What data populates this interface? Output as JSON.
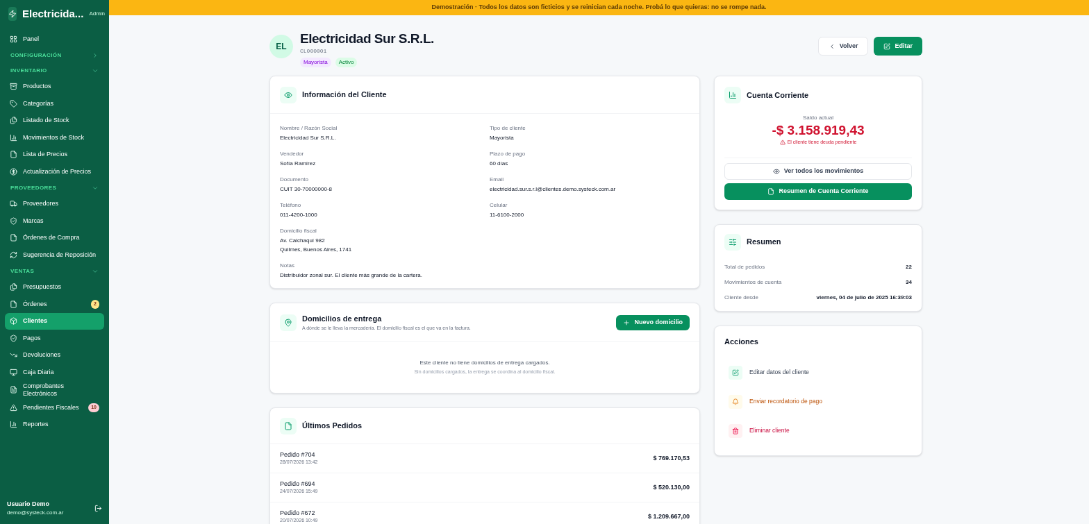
{
  "banner": "Demostración · Todos los datos son ficticios y se reinician cada noche. Probá lo que quieras: no se rompe nada.",
  "sidebar": {
    "brand": "Electricida...",
    "role": "Admin",
    "items": [
      {
        "kind": "link",
        "label": "Panel",
        "selected": false
      },
      {
        "kind": "section",
        "label": "CONFIGURACIÓN",
        "expanded": false
      },
      {
        "kind": "section",
        "label": "INVENTARIO",
        "expanded": true
      },
      {
        "kind": "link",
        "label": "Productos",
        "selected": false
      },
      {
        "kind": "link",
        "label": "Categorías",
        "selected": false
      },
      {
        "kind": "link",
        "label": "Listado de Stock",
        "selected": false
      },
      {
        "kind": "link",
        "label": "Movimientos de Stock",
        "selected": false
      },
      {
        "kind": "link",
        "label": "Lista de Precios",
        "selected": false
      },
      {
        "kind": "link",
        "label": "Actualización de Precios",
        "selected": false
      },
      {
        "kind": "section",
        "label": "PROVEEDORES",
        "expanded": true
      },
      {
        "kind": "link",
        "label": "Proveedores",
        "selected": false
      },
      {
        "kind": "link",
        "label": "Marcas",
        "selected": false
      },
      {
        "kind": "link",
        "label": "Órdenes de Compra",
        "selected": false
      },
      {
        "kind": "link",
        "label": "Sugerencia de Reposición",
        "selected": false
      },
      {
        "kind": "section",
        "label": "VENTAS",
        "expanded": true
      },
      {
        "kind": "link",
        "label": "Presupuestos",
        "selected": false
      },
      {
        "kind": "link",
        "label": "Órdenes",
        "selected": false,
        "badge": {
          "text": "2",
          "color": "#fde68a"
        }
      },
      {
        "kind": "link",
        "label": "Clientes",
        "selected": true
      },
      {
        "kind": "link",
        "label": "Pagos",
        "selected": false
      },
      {
        "kind": "link",
        "label": "Devoluciones",
        "selected": false
      },
      {
        "kind": "link",
        "label": "Caja Diaria",
        "selected": false
      },
      {
        "kind": "link",
        "label": "Comprobantes Electrónicos",
        "selected": false
      },
      {
        "kind": "link",
        "label": "Pendientes Fiscales",
        "selected": false,
        "badge": {
          "text": "10",
          "color": "#fecdd3"
        }
      },
      {
        "kind": "link",
        "label": "Reportes",
        "selected": false
      }
    ],
    "user": {
      "name": "Usuario Demo",
      "email": "demo@systeck.com.ar"
    }
  },
  "client": {
    "initials": "EL",
    "name": "Electricidad Sur S.R.L.",
    "code": "CL000001",
    "tags": [
      {
        "label": "Mayorista",
        "color": "#f3e8ff"
      },
      {
        "label": "Activo",
        "color": "#dcfce7"
      }
    ]
  },
  "header_buttons": [
    {
      "label": "Volver",
      "kind": "secondary"
    },
    {
      "label": "Editar",
      "kind": "primary"
    }
  ],
  "info_card": {
    "title": "Información del Cliente",
    "rows": [
      [
        {
          "label": "Nombre / Razón Social",
          "lines": [
            "Electricidad Sur S.R.L."
          ]
        },
        {
          "label": "Tipo de cliente",
          "lines": [
            "Mayorista"
          ]
        }
      ],
      [
        {
          "label": "Vendedor",
          "lines": [
            "Sofía Ramírez"
          ]
        },
        {
          "label": "Plazo de pago",
          "lines": [
            "60 días"
          ]
        }
      ],
      [
        {
          "label": "Documento",
          "lines": [
            "CUIT 30-70000000-8"
          ]
        },
        {
          "label": "Email",
          "lines": [
            "electricidad.sur.s.r.l@clientes.demo.systeck.com.ar"
          ]
        }
      ],
      [
        {
          "label": "Teléfono",
          "lines": [
            "011-4200-1000"
          ]
        },
        {
          "label": "Celular",
          "lines": [
            "11-6100-2000"
          ]
        }
      ],
      [
        {
          "label": "Domicilio fiscal",
          "lines": [
            "Av. Calchaquí 982",
            "Quilmes, Buenos Aires, 1741"
          ]
        }
      ],
      [
        {
          "label": "Notas",
          "lines": [
            "Distribuidor zonal sur. El cliente más grande de la cartera."
          ]
        }
      ]
    ]
  },
  "deliveries": {
    "title": "Domicilios de entrega",
    "subtitle": "A dónde se le lleva la mercadería. El domicilio fiscal es el que va en la factura.",
    "button": "Nuevo domicilio",
    "empty_title": "Este cliente no tiene domicilios de entrega cargados.",
    "empty_hint": "Sin domicilios cargados, la entrega se coordina al domicilio fiscal."
  },
  "orders": {
    "title": "Últimos Pedidos",
    "rows": [
      {
        "name": "Pedido #704",
        "date": "28/07/2026 13:42",
        "amount": "$ 769.170,53"
      },
      {
        "name": "Pedido #694",
        "date": "24/07/2026 15:49",
        "amount": "$ 520.130,00"
      },
      {
        "name": "Pedido #672",
        "date": "20/07/2026 10:49",
        "amount": "$ 1.209.667,00"
      }
    ]
  },
  "account": {
    "title": "Cuenta Corriente",
    "balance_label": "Saldo actual",
    "balance": "-$ 3.158.919,43",
    "warning": "El cliente tiene deuda pendiente",
    "buttons": [
      {
        "label": "Ver todos los movimientos",
        "kind": "secondary"
      },
      {
        "label": "Resumen de Cuenta Corriente",
        "kind": "primary"
      }
    ]
  },
  "summary": {
    "title": "Resumen",
    "rows": [
      {
        "label": "Total de pedidos",
        "value": "22"
      },
      {
        "label": "Movimientos de cuenta",
        "value": "34"
      },
      {
        "label": "Cliente desde",
        "value": "viernes, 04 de julio de 2025 16:39:03"
      }
    ]
  },
  "actions": {
    "title": "Acciones",
    "items": [
      {
        "label": "Editar datos del cliente",
        "kind": "edit"
      },
      {
        "label": "Enviar recordatorio de pago",
        "kind": "reminder"
      },
      {
        "label": "Eliminar cliente",
        "kind": "delete"
      }
    ]
  }
}
